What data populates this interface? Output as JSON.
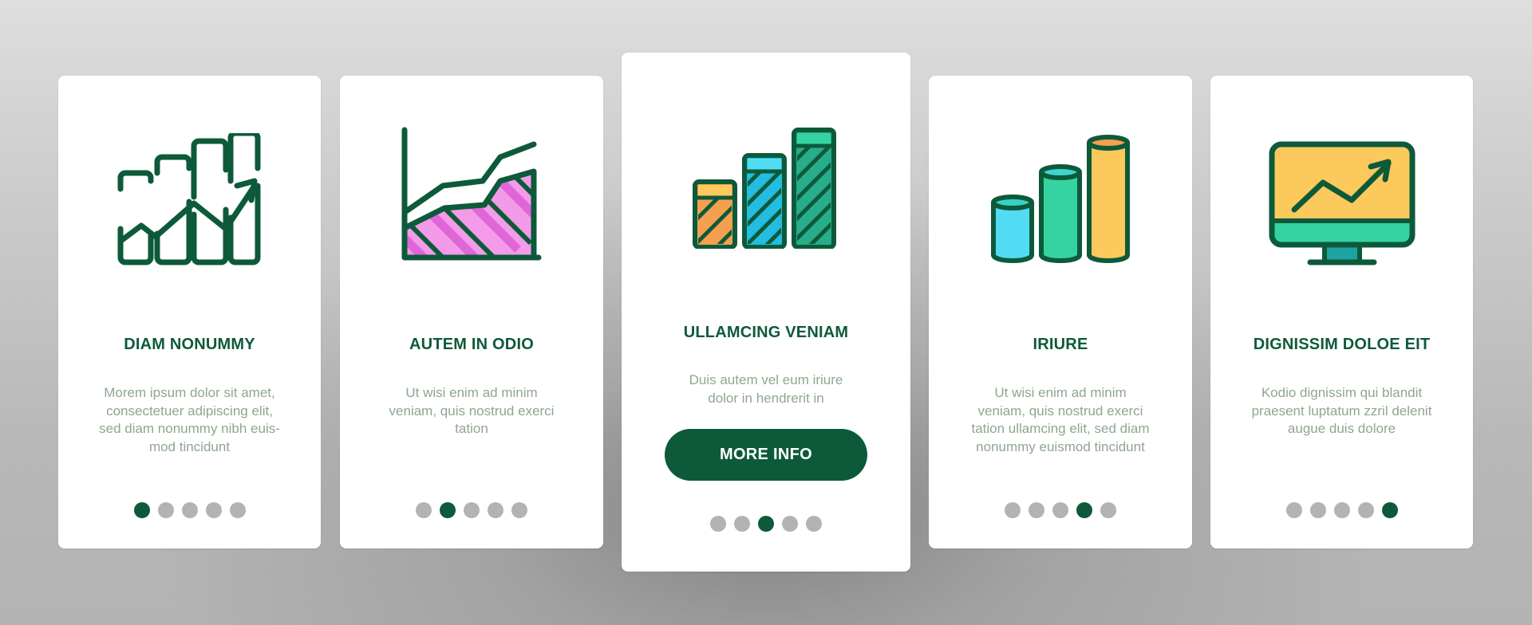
{
  "theme": {
    "primary": "#0d5a3a",
    "body_text": "#8fa68f",
    "dot_inactive": "#b3b3b3",
    "card_bg": "#ffffff"
  },
  "cards": [
    {
      "icon": "bar-chart-growth-arrow-icon",
      "title": "DIAM NONUMMY",
      "body": "Morem ipsum dolor sit amet, consectetuer adipiscing elit, sed diam nonummy nibh euis-mod tincidunt",
      "body_lines": [
        "Morem ipsum dolor sit amet,",
        "consectetuer adipiscing elit,",
        "sed diam nonummy nibh euis-",
        "mod tincidunt"
      ],
      "active_dot": 1
    },
    {
      "icon": "area-chart-icon",
      "title": "AUTEM IN ODIO",
      "body": "Ut wisi enim ad minim veniam, quis nostrud exerci tation",
      "body_lines": [
        "Ut wisi enim ad minim",
        "veniam, quis nostrud exerci",
        "tation"
      ],
      "active_dot": 2
    },
    {
      "icon": "striped-bar-chart-icon",
      "title": "ULLAMCING VENIAM",
      "body": "Duis autem vel eum iriure dolor in hendrerit in",
      "body_lines": [
        "Duis autem vel eum iriure",
        "dolor in hendrerit in"
      ],
      "button_label": "MORE INFO",
      "active_dot": 3
    },
    {
      "icon": "cylinder-bar-chart-icon",
      "title": "IRIURE",
      "body": "Ut wisi enim ad minim veniam, quis nostrud exerci tation ullamcing elit, sed diam nonummy euismod tincidunt",
      "body_lines": [
        "Ut wisi enim ad minim",
        "veniam, quis nostrud exerci",
        "tation ullamcing elit, sed diam",
        "nonummy euismod tincidunt"
      ],
      "active_dot": 4
    },
    {
      "icon": "monitor-growth-chart-icon",
      "title": "DIGNISSIM DOLOE EIT",
      "body": "Kodio dignissim qui blandit praesent luptatum zzril delenit augue duis dolore",
      "body_lines": [
        "Kodio dignissim qui blandit",
        "praesent luptatum zzril delenit",
        "augue duis dolore"
      ],
      "active_dot": 5
    }
  ],
  "pagination": {
    "total": 5
  }
}
